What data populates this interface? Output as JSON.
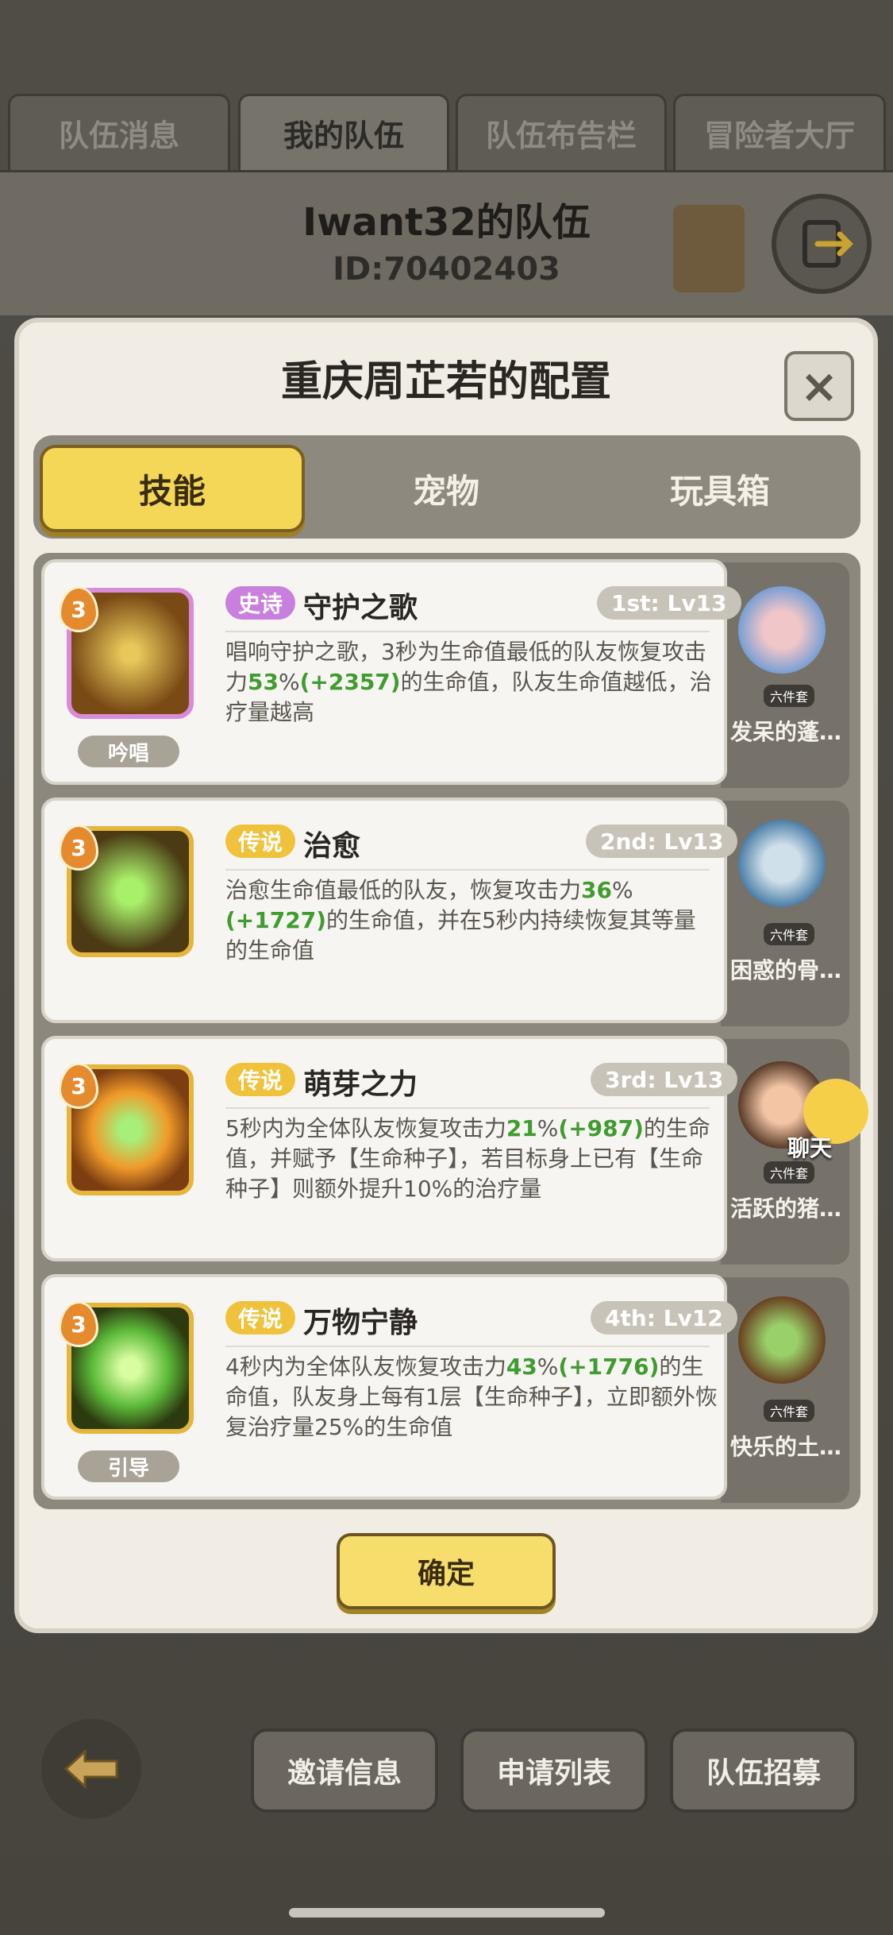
{
  "top_tabs": [
    {
      "label": "队伍消息"
    },
    {
      "label": "我的队伍"
    },
    {
      "label": "队伍布告栏"
    },
    {
      "label": "冒险者大厅"
    }
  ],
  "team": {
    "title": "Iwant32的队伍",
    "id": "ID:70402403"
  },
  "modal": {
    "title": "重庆周芷若的配置",
    "close_label": "×",
    "tabs": [
      {
        "label": "技能"
      },
      {
        "label": "宠物"
      },
      {
        "label": "玩具箱"
      }
    ],
    "confirm_label": "确定"
  },
  "skills": [
    {
      "rank": "3",
      "tag": "史诗",
      "tag_color": "#c97fde",
      "name": "守护之歌",
      "level": "1st: Lv13",
      "desc_pre": "唱响守护之歌，3秒为生命值最低的队友恢复攻击力",
      "pct": "53",
      "pct_unit": "%",
      "bonus": "(+2357)",
      "desc_post": "的生命值，队友生命值越低，治疗量越高",
      "sub": "吟唱"
    },
    {
      "rank": "3",
      "tag": "传说",
      "tag_color": "#f0c23c",
      "name": "治愈",
      "level": "2nd: Lv13",
      "desc_pre": "治愈生命值最低的队友，恢复攻击力",
      "pct": "36",
      "pct_unit": "%",
      "bonus": "(+1727)",
      "desc_post": "的生命值，并在5秒内持续恢复其等量的生命值",
      "sub": ""
    },
    {
      "rank": "3",
      "tag": "传说",
      "tag_color": "#f0c23c",
      "name": "萌芽之力",
      "level": "3rd: Lv13",
      "desc_pre": "5秒内为全体队友恢复攻击力",
      "pct": "21",
      "pct_unit": "%",
      "bonus": "(+987)",
      "desc_post": "的生命值，并赋予【生命种子】，若目标身上已有【生命种子】则额外提升10%的治疗量",
      "sub": ""
    },
    {
      "rank": "3",
      "tag": "传说",
      "tag_color": "#f0c23c",
      "name": "万物宁静",
      "level": "4th: Lv12",
      "desc_pre": "4秒内为全体队友恢复攻击力",
      "pct": "43",
      "pct_unit": "%",
      "bonus": "(+1776)",
      "desc_post": "的生命值，队友身上每有1层【生命种子】，立即额外恢复治疗量25%的生命值",
      "sub": "引导"
    }
  ],
  "pets": [
    {
      "name": "发呆的蓬…",
      "set": "六件套"
    },
    {
      "name": "困惑的骨…",
      "set": "六件套"
    },
    {
      "name": "活跃的猪…",
      "set": "六件套"
    },
    {
      "name": "快乐的土…",
      "set": "六件套"
    }
  ],
  "chat": {
    "label": "聊天"
  },
  "bottom_buttons": [
    {
      "label": "邀请信息"
    },
    {
      "label": "申请列表"
    },
    {
      "label": "队伍招募"
    }
  ]
}
